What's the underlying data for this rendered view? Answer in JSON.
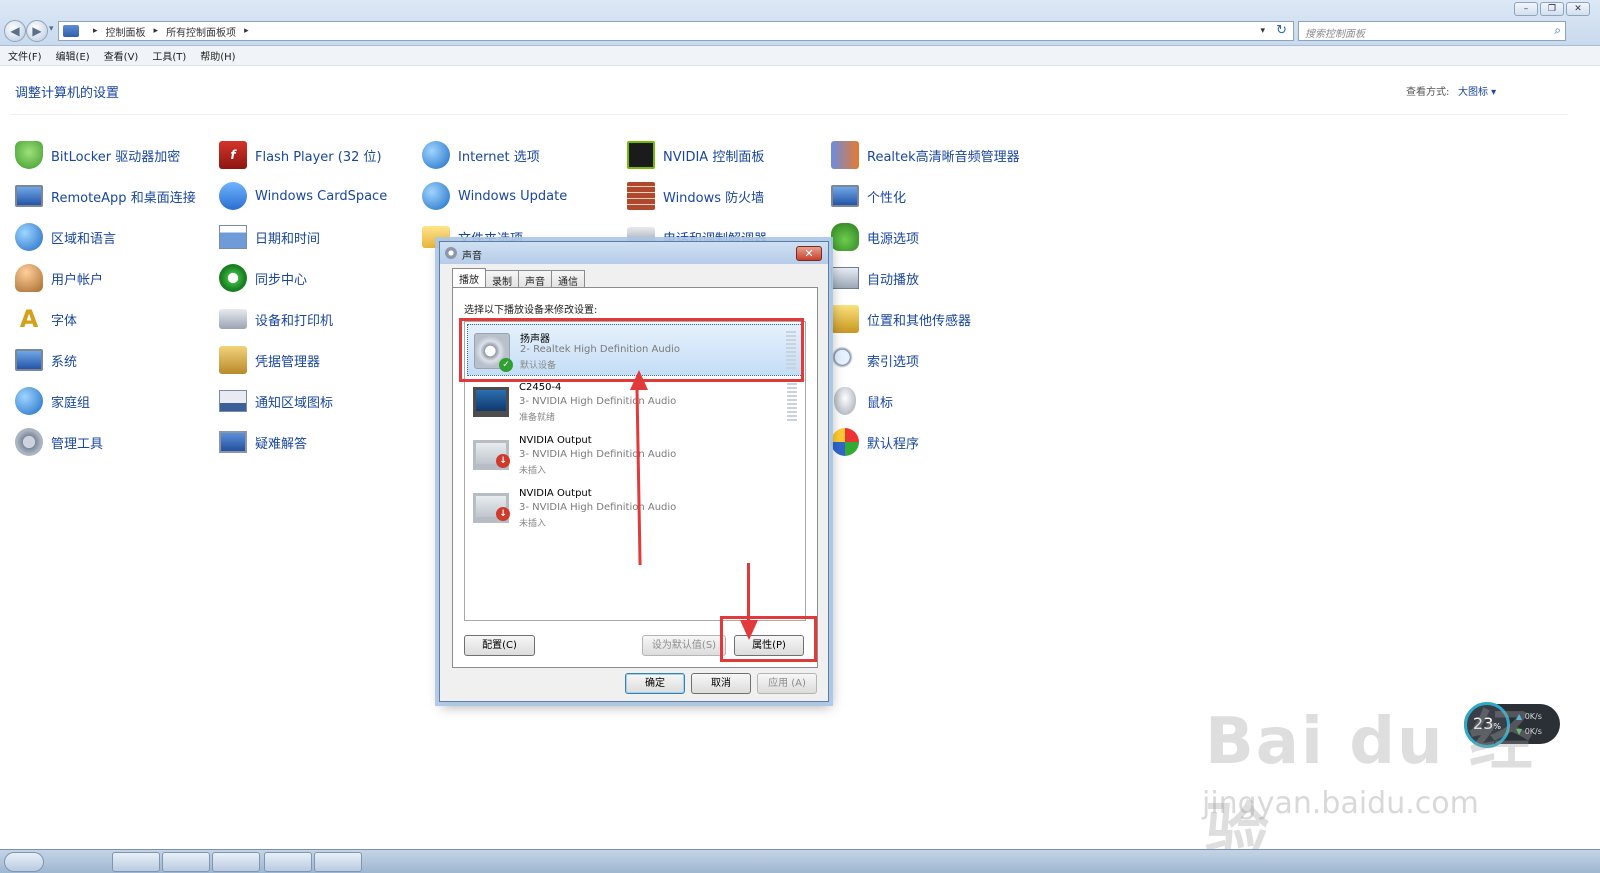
{
  "window": {
    "breadcrumb": [
      "控制面板",
      "所有控制面板项"
    ],
    "search_placeholder": "搜索控制面板"
  },
  "menu": [
    "文件(F)",
    "编辑(E)",
    "查看(V)",
    "工具(T)",
    "帮助(H)"
  ],
  "header": {
    "title": "调整计算机的设置",
    "view_by_label": "查看方式:",
    "view_by_value": "大图标 ▾"
  },
  "columns": [
    {
      "items": [
        {
          "label": "BitLocker 驱动器加密",
          "icon": "shield-icon"
        },
        {
          "label": "RemoteApp 和桌面连接",
          "icon": "monitor-icon"
        },
        {
          "label": "区域和语言",
          "icon": "globe-icon"
        },
        {
          "label": "用户帐户",
          "icon": "people-icon"
        },
        {
          "label": "字体",
          "icon": "font-icon"
        },
        {
          "label": "系统",
          "icon": "monitor-icon"
        },
        {
          "label": "家庭组",
          "icon": "globe-icon"
        },
        {
          "label": "管理工具",
          "icon": "gear-icon"
        }
      ]
    },
    {
      "items": [
        {
          "label": "Flash Player (32 位)",
          "icon": "flash-icon"
        },
        {
          "label": "Windows CardSpace",
          "icon": "shield-icon"
        },
        {
          "label": "日期和时间",
          "icon": "calendar-icon"
        },
        {
          "label": "同步中心",
          "icon": "sync-icon"
        },
        {
          "label": "设备和打印机",
          "icon": "printer-icon"
        },
        {
          "label": "凭据管理器",
          "icon": "vault-icon"
        },
        {
          "label": "通知区域图标",
          "icon": "tray-icon"
        },
        {
          "label": "疑难解答",
          "icon": "help-icon"
        }
      ]
    },
    {
      "items": [
        {
          "label": "Internet 选项",
          "icon": "globe-icon"
        },
        {
          "label": "Windows Update",
          "icon": "globe-icon"
        },
        {
          "label": "文件夹选项",
          "icon": "folder-icon"
        }
      ]
    },
    {
      "items": [
        {
          "label": "NVIDIA 控制面板",
          "icon": "nvidia-icon"
        },
        {
          "label": "Windows 防火墙",
          "icon": "firewall-icon"
        },
        {
          "label": "电话和调制解调器",
          "icon": "phone-icon"
        }
      ]
    },
    {
      "items": [
        {
          "label": "Realtek高清晰音频管理器",
          "icon": "equalizer-icon"
        },
        {
          "label": "个性化",
          "icon": "monitor-icon"
        },
        {
          "label": "电源选项",
          "icon": "power-icon"
        },
        {
          "label": "自动播放",
          "icon": "autoplay-icon"
        },
        {
          "label": "位置和其他传感器",
          "icon": "sensor-icon"
        },
        {
          "label": "索引选项",
          "icon": "magnifier-icon"
        },
        {
          "label": "鼠标",
          "icon": "mouse-icon"
        },
        {
          "label": "默认程序",
          "icon": "default-programs-icon"
        }
      ]
    }
  ],
  "dialog": {
    "title": "声音",
    "tabs": [
      "播放",
      "录制",
      "声音",
      "通信"
    ],
    "instruction": "选择以下播放设备来修改设置:",
    "devices": [
      {
        "name": "扬声器",
        "desc": "2- Realtek High Definition Audio",
        "status": "默认设备"
      },
      {
        "name": "C2450-4",
        "desc": "3- NVIDIA High Definition Audio",
        "status": "准备就绪"
      },
      {
        "name": "NVIDIA Output",
        "desc": "3- NVIDIA High Definition Audio",
        "status": "未插入"
      },
      {
        "name": "NVIDIA Output",
        "desc": "3- NVIDIA High Definition Audio",
        "status": "未插入"
      }
    ],
    "buttons": {
      "configure": "配置(C)",
      "set_default": "设为默认值(S)",
      "properties": "属性(P)",
      "ok": "确定",
      "cancel": "取消",
      "apply": "应用 (A)"
    }
  },
  "widget": {
    "percent": "23",
    "percent_unit": "%",
    "up": "0K/s",
    "down": "0K/s"
  },
  "watermark": {
    "brand": "Bai du 经验",
    "url": "jingyan.baidu.com"
  }
}
